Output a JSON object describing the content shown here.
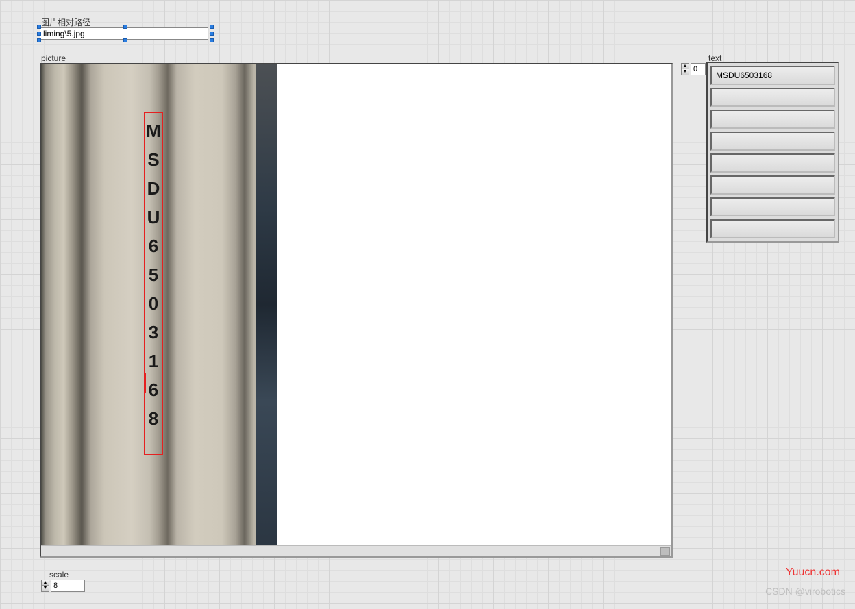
{
  "path": {
    "label": "图片相对路径",
    "value": "liming\\5.jpg"
  },
  "picture": {
    "label": "picture",
    "detected_text": "MSDU6503168",
    "characters": [
      "M",
      "S",
      "D",
      "U",
      "6",
      "5",
      "0",
      "3",
      "1",
      "6",
      "8"
    ]
  },
  "text_array": {
    "label": "text",
    "index": "0",
    "rows": [
      "MSDU6503168",
      "",
      "",
      "",
      "",
      "",
      "",
      ""
    ]
  },
  "scale": {
    "label": "scale",
    "value": "8"
  },
  "watermark": {
    "site": "Yuucn.com",
    "credit": "CSDN @virobotics"
  }
}
